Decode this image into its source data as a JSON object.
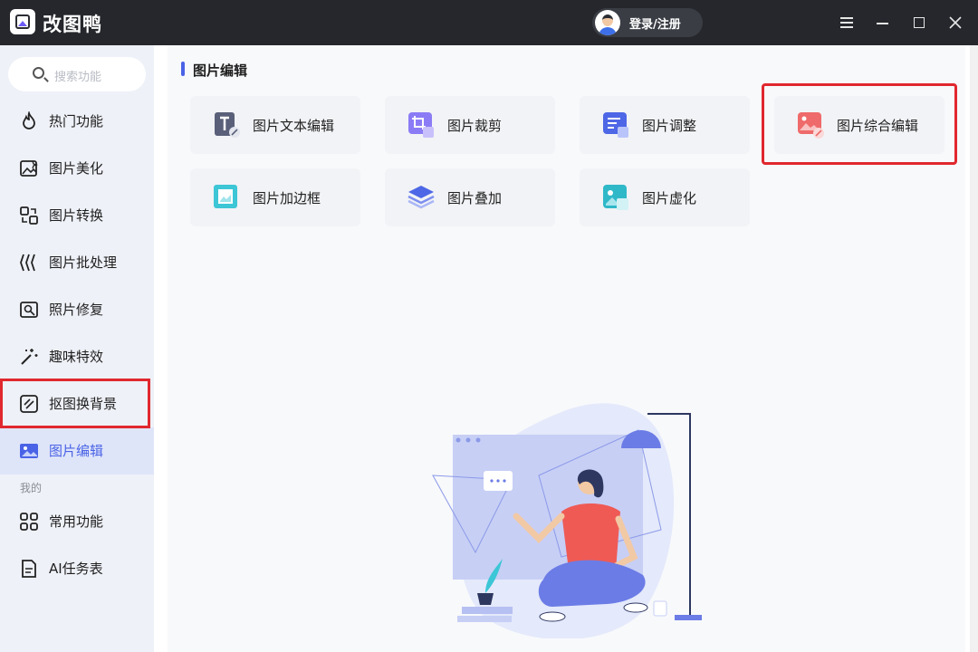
{
  "app": {
    "title": "改图鸭",
    "login_label": "登录/注册"
  },
  "sidebar": {
    "search_placeholder": "搜索功能",
    "items": [
      {
        "label": "热门功能",
        "icon": "flame-icon"
      },
      {
        "label": "图片美化",
        "icon": "image-sparkle-icon"
      },
      {
        "label": "图片转换",
        "icon": "convert-icon"
      },
      {
        "label": "图片批处理",
        "icon": "batch-icon"
      },
      {
        "label": "照片修复",
        "icon": "photo-repair-icon"
      },
      {
        "label": "趣味特效",
        "icon": "magic-wand-icon"
      },
      {
        "label": "抠图换背景",
        "icon": "cutout-icon"
      },
      {
        "label": "图片编辑",
        "icon": "image-edit-icon",
        "active": true
      }
    ],
    "section_label": "我的",
    "my_items": [
      {
        "label": "常用功能",
        "icon": "grid-icon"
      },
      {
        "label": "AI任务表",
        "icon": "document-icon"
      }
    ]
  },
  "main": {
    "section_title": "图片编辑",
    "tools": [
      {
        "label": "图片文本编辑",
        "icon": "text-edit-icon"
      },
      {
        "label": "图片裁剪",
        "icon": "crop-icon"
      },
      {
        "label": "图片调整",
        "icon": "adjust-icon"
      },
      {
        "label": "图片综合编辑",
        "icon": "comprehensive-edit-icon",
        "highlighted": true
      },
      {
        "label": "图片加边框",
        "icon": "border-icon"
      },
      {
        "label": "图片叠加",
        "icon": "overlay-icon"
      },
      {
        "label": "图片虚化",
        "icon": "blur-icon"
      }
    ]
  },
  "colors": {
    "accent": "#4a63e6",
    "highlight": "#e0282e",
    "titlebar": "#25272c"
  }
}
